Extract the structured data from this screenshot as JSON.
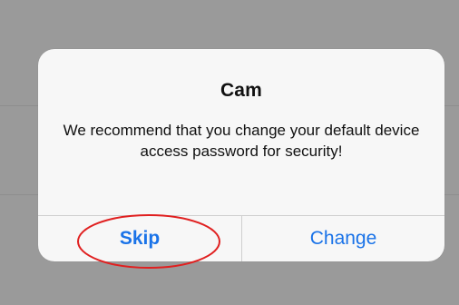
{
  "dialog": {
    "title": "Cam",
    "message": "We recommend that you change your default device access password for security!",
    "buttons": {
      "skip_label": "Skip",
      "change_label": "Change"
    }
  },
  "colors": {
    "overlay_background": "#9a9a9a",
    "dialog_background": "#f7f7f7",
    "button_text": "#1a73e8",
    "annotation": "#e02020"
  }
}
